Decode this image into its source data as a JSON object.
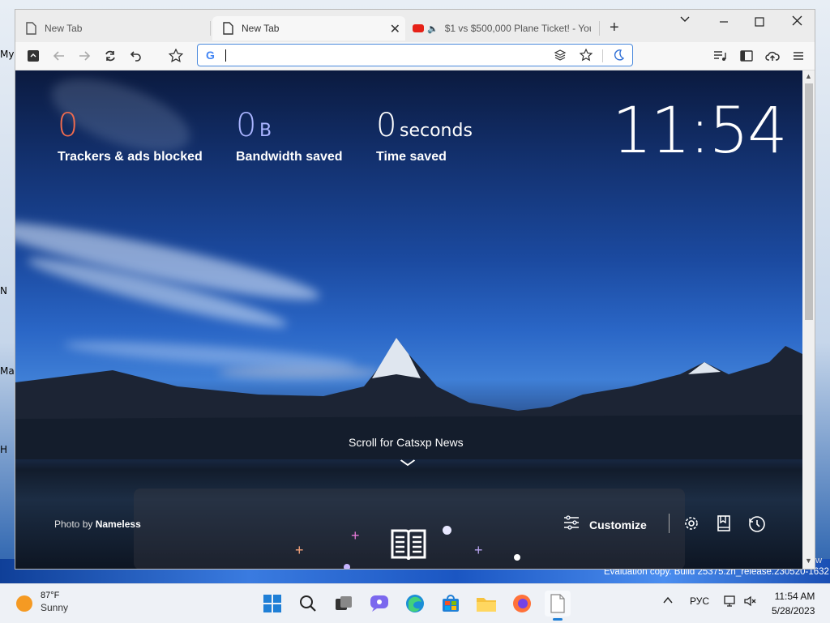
{
  "desktop": {
    "labels": [
      "My",
      "N",
      "Ma",
      "H"
    ],
    "evaluation_text": "Evaluation copy. Build 25375.zn_release.230520-1632",
    "edge_text": "ew"
  },
  "browser": {
    "tabs": [
      {
        "title": "New Tab"
      },
      {
        "title": "New Tab"
      },
      {
        "title": "$1 vs $500,000 Plane Ticket! - You"
      }
    ],
    "tab_close_glyph": "✕",
    "new_tab_glyph": "+",
    "address": {
      "value": "",
      "placeholder": "",
      "engine_glyph": "G"
    }
  },
  "newtab": {
    "stats": [
      {
        "value": "0",
        "unit": "",
        "label": "Trackers & ads blocked",
        "color": "#f06b4e"
      },
      {
        "value": "0",
        "unit": "B",
        "label": "Bandwidth saved",
        "color": "#a9b4ff"
      },
      {
        "value": "0",
        "unit": "seconds",
        "label": "Time saved",
        "color": "#ffffff"
      }
    ],
    "clock": "11:54",
    "scroll_text": "Scroll for Catsxp News",
    "photo_credit_prefix": "Photo by",
    "photo_credit_name": "Nameless",
    "customize_label": "Customize"
  },
  "taskbar": {
    "weather_temp": "87°F",
    "weather_cond": "Sunny",
    "language": "РУС",
    "time": "11:54 AM",
    "date": "5/28/2023"
  },
  "colors": {
    "accent": "#4a89dc",
    "tracker_orange": "#f06b4e"
  }
}
